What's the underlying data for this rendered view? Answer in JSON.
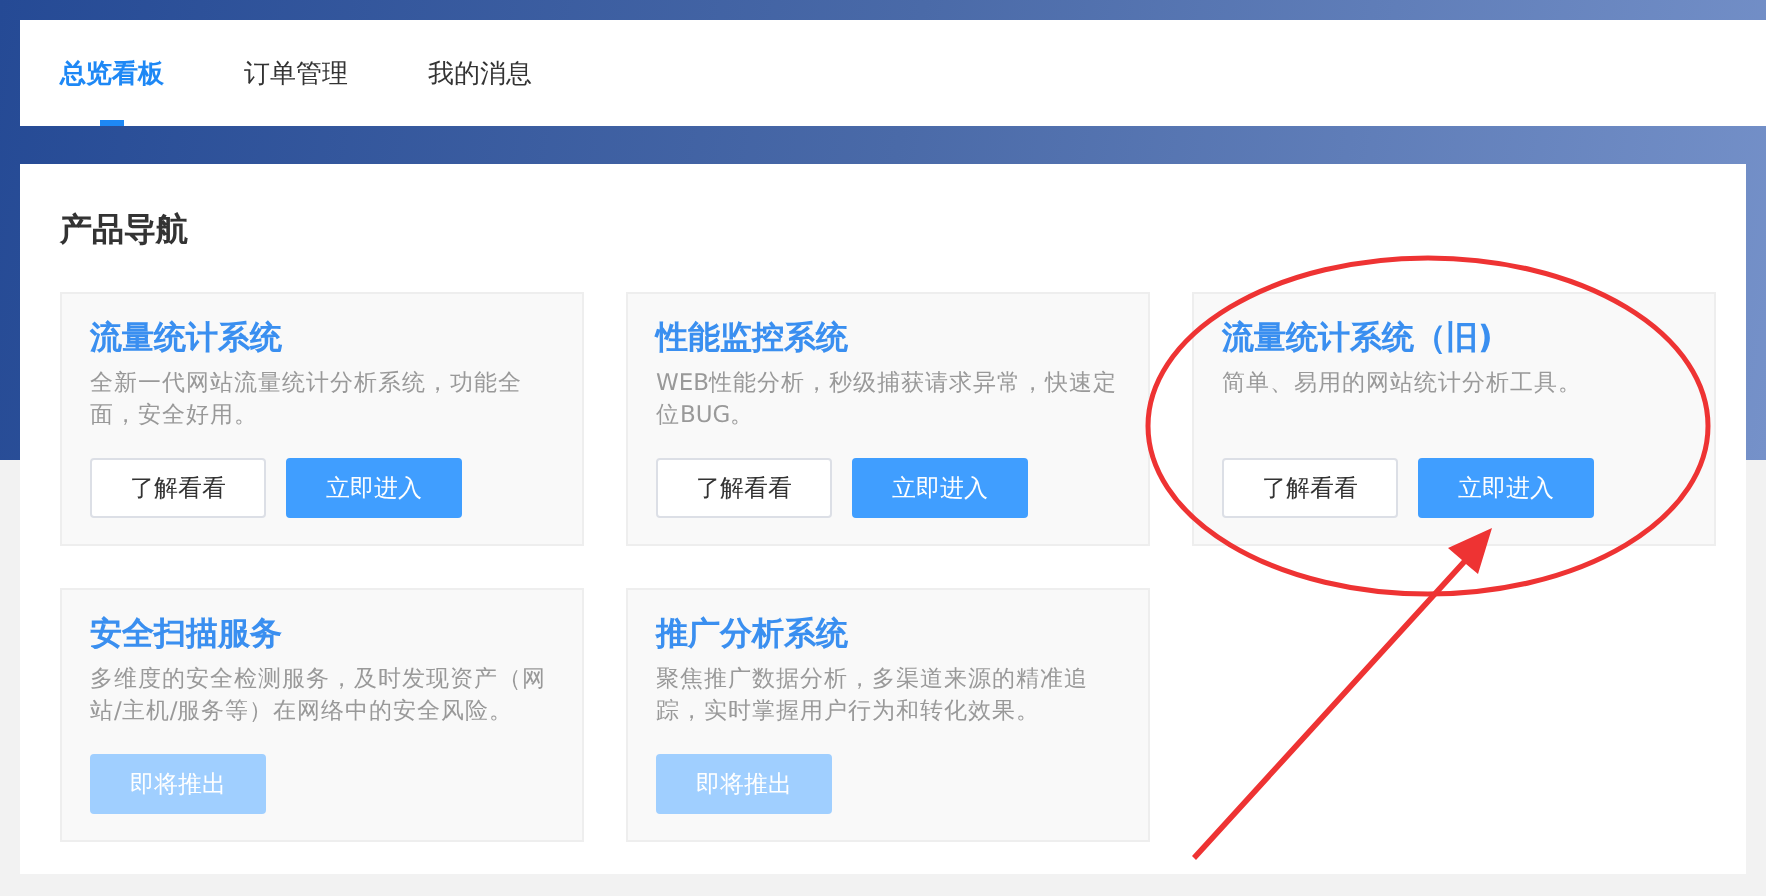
{
  "tabs": [
    {
      "label": "总览看板",
      "selected": true
    },
    {
      "label": "订单管理",
      "selected": false
    },
    {
      "label": "我的消息",
      "selected": false
    }
  ],
  "section_title": "产品导航",
  "products": [
    {
      "title": "流量统计系统",
      "description": "全新一代网站流量统计分析系统，功能全面，安全好用。",
      "buttons": [
        {
          "label": "了解看看",
          "kind": "secondary",
          "disabled": false
        },
        {
          "label": "立即进入",
          "kind": "primary",
          "disabled": false
        }
      ]
    },
    {
      "title": "性能监控系统",
      "description": "WEB性能分析，秒级捕获请求异常，快速定位BUG。",
      "buttons": [
        {
          "label": "了解看看",
          "kind": "secondary",
          "disabled": false
        },
        {
          "label": "立即进入",
          "kind": "primary",
          "disabled": false
        }
      ]
    },
    {
      "title": "流量统计系统（旧)",
      "description": "简单、易用的网站统计分析工具。",
      "buttons": [
        {
          "label": "了解看看",
          "kind": "secondary",
          "disabled": false
        },
        {
          "label": "立即进入",
          "kind": "primary",
          "disabled": false
        }
      ]
    },
    {
      "title": "安全扫描服务",
      "description": "多维度的安全检测服务，及时发现资产（网站/主机/服务等）在网络中的安全风险。",
      "buttons": [
        {
          "label": "即将推出",
          "kind": "primary",
          "disabled": true
        }
      ]
    },
    {
      "title": "推广分析系统",
      "description": "聚焦推广数据分析，多渠道来源的精准追踪，实时掌握用户行为和转化效果。",
      "buttons": [
        {
          "label": "即将推出",
          "kind": "primary",
          "disabled": true
        }
      ]
    }
  ]
}
